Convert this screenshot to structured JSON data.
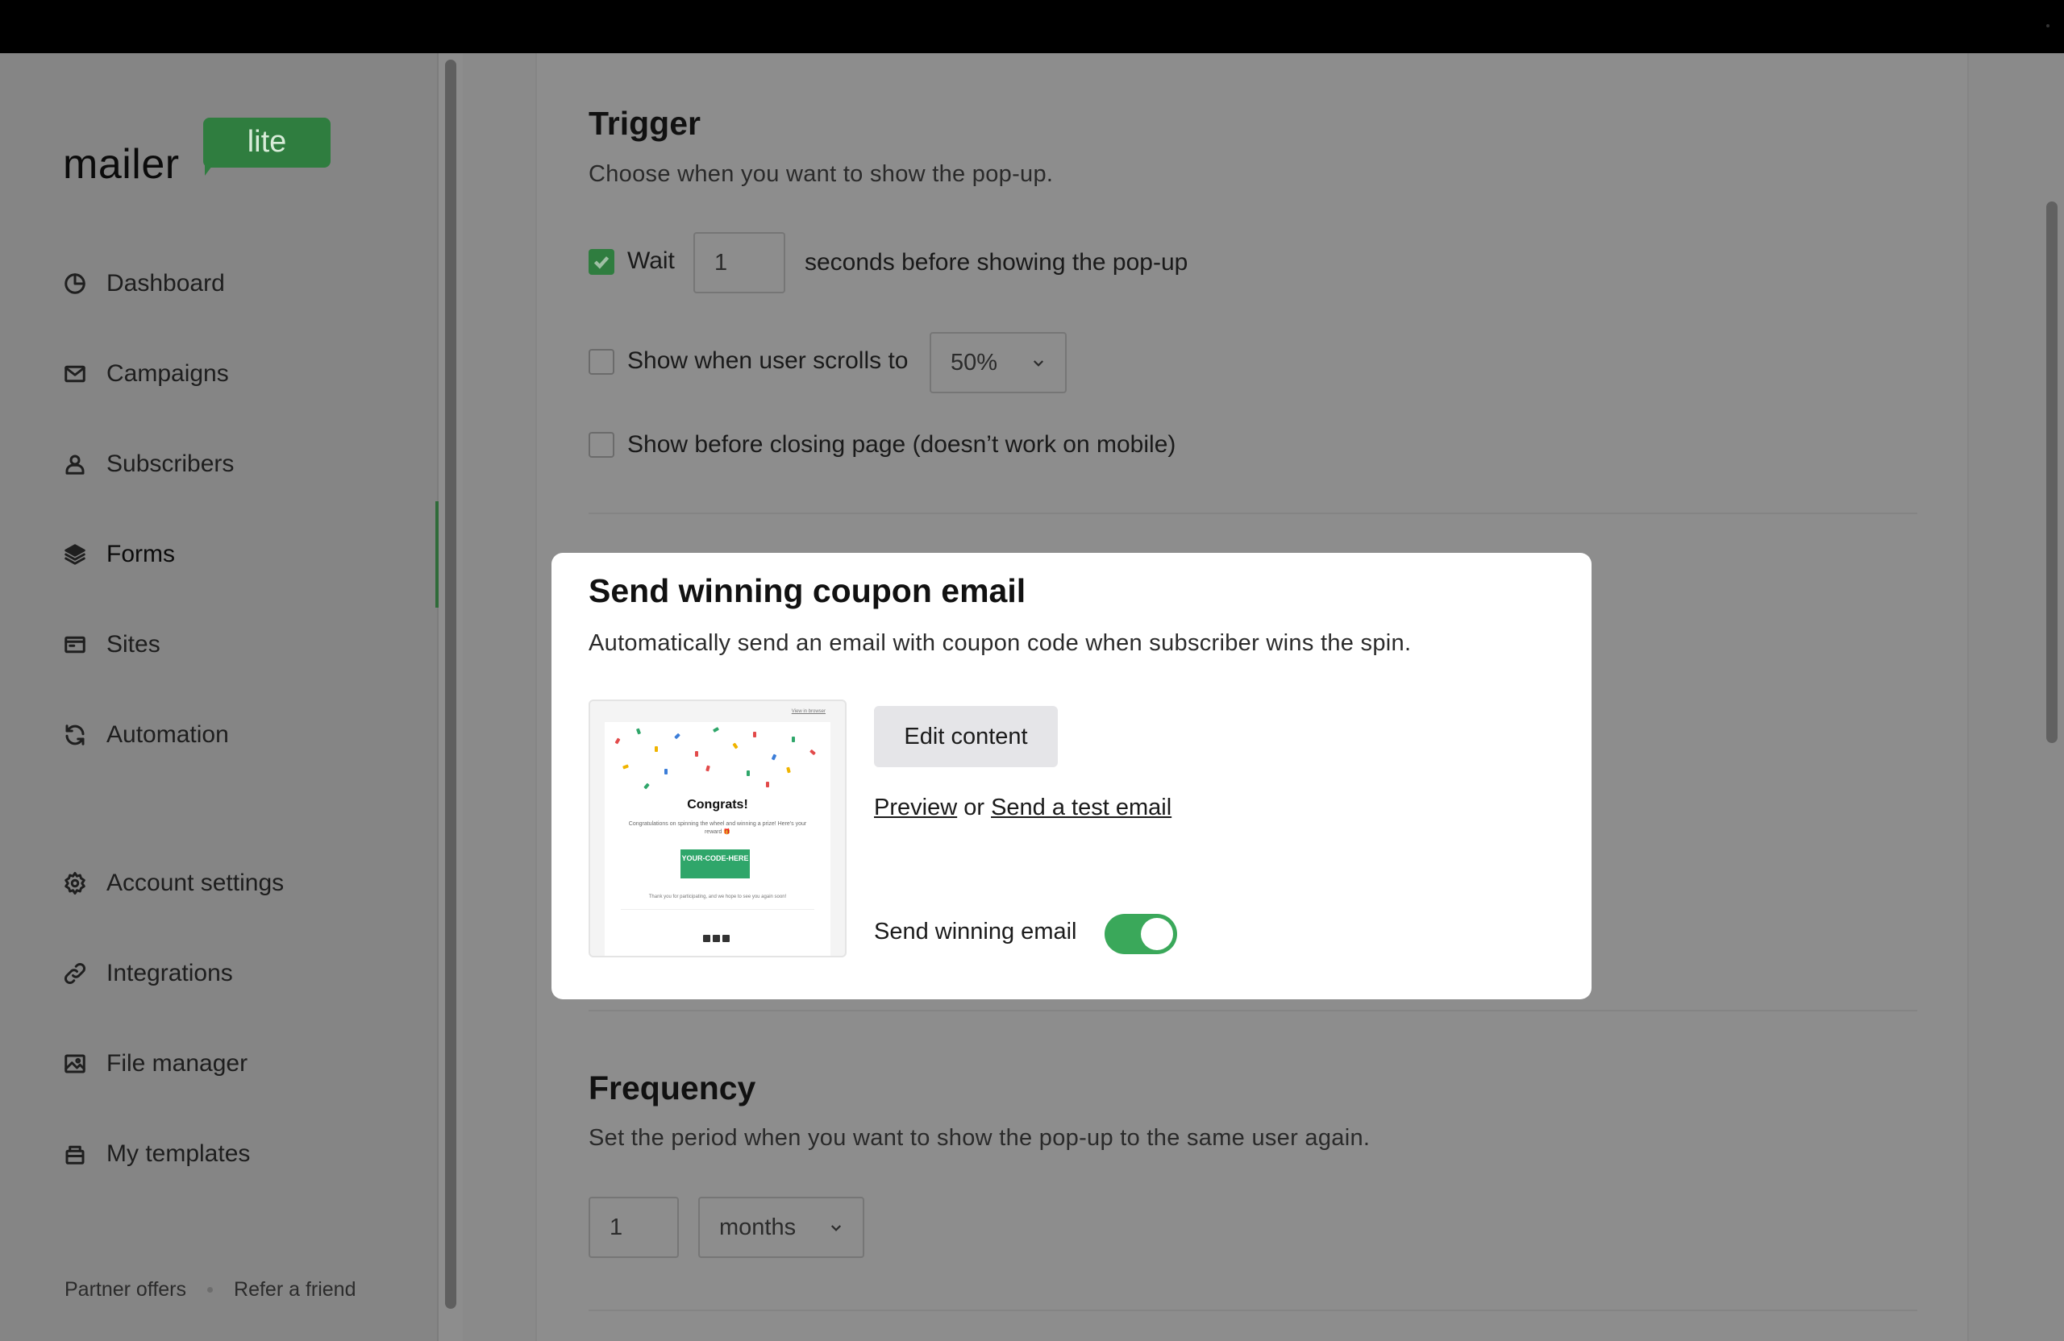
{
  "brand": {
    "word": "mailer",
    "badge": "lite"
  },
  "sidebar": {
    "items": [
      {
        "label": "Dashboard",
        "icon": "dashboard-icon"
      },
      {
        "label": "Campaigns",
        "icon": "mail-icon"
      },
      {
        "label": "Subscribers",
        "icon": "user-icon"
      },
      {
        "label": "Forms",
        "icon": "layers-icon",
        "active": true
      },
      {
        "label": "Sites",
        "icon": "browser-icon"
      },
      {
        "label": "Automation",
        "icon": "refresh-icon"
      },
      {
        "label": "Account settings",
        "icon": "gear-icon"
      },
      {
        "label": "Integrations",
        "icon": "link-icon"
      },
      {
        "label": "File manager",
        "icon": "image-icon"
      },
      {
        "label": "My templates",
        "icon": "template-icon"
      }
    ],
    "footer": {
      "partner": "Partner offers",
      "refer": "Refer a friend"
    }
  },
  "trigger": {
    "title": "Trigger",
    "subtitle": "Choose when you want to show the pop-up.",
    "wait_label": "Wait",
    "wait_value": "1",
    "wait_suffix": "seconds before showing the pop-up",
    "scroll_label": "Show when user scrolls to",
    "scroll_value": "50%",
    "closing_label": "Show before closing page (doesn’t work on mobile)"
  },
  "modal": {
    "title": "Send winning coupon email",
    "description": "Automatically send an email with coupon code when subscriber wins the spin.",
    "edit_button": "Edit content",
    "preview_link": "Preview",
    "or_text": "or",
    "test_link": "Send a test email",
    "toggle_label": "Send winning email",
    "toggle_on": true,
    "thumbnail": {
      "view_link": "View in browser",
      "heading": "Congrats!",
      "message": "Congratulations on spinning the wheel and winning a prize! Here's your reward 🎁",
      "code": "YOUR-CODE-HERE",
      "thanks": "Thank you for participating, and we hope to see you again soon!"
    }
  },
  "frequency": {
    "title": "Frequency",
    "subtitle": "Set the period when you want to show the pop-up to the same user again.",
    "value": "1",
    "unit": "months"
  },
  "colors": {
    "accent": "#2f7d3f",
    "toggle": "#3aa85a",
    "overlay": "#8d8d8d"
  }
}
